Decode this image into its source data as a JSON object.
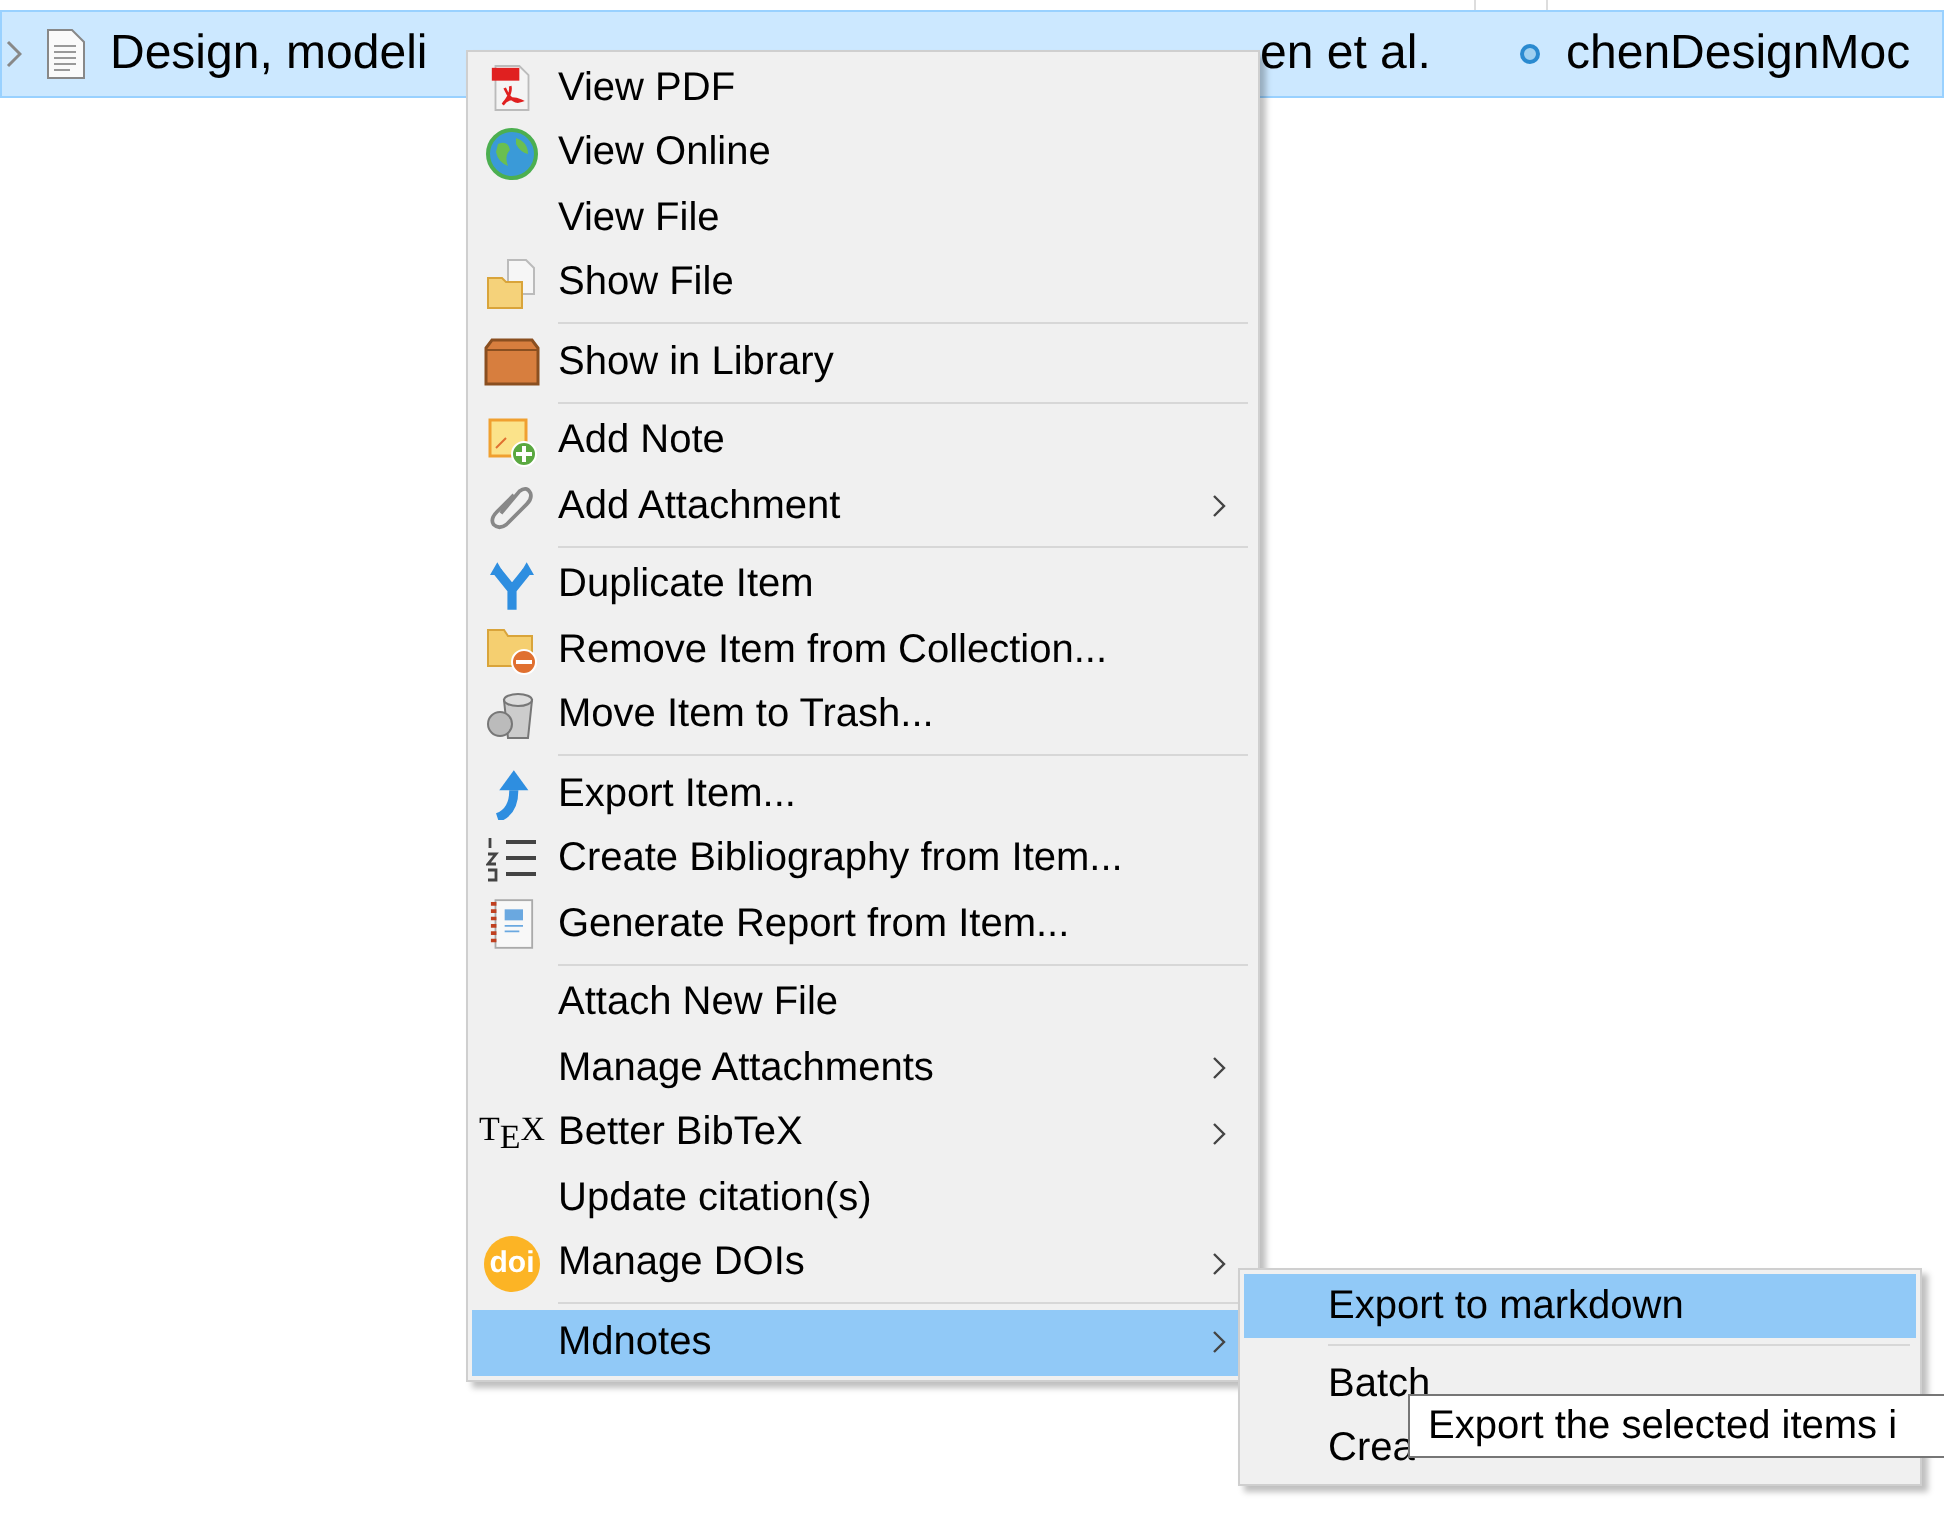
{
  "item_row": {
    "selected": true,
    "title": "Design, modeli",
    "creator": "en et al.",
    "citekey": "chenDesignMoc"
  },
  "context_menu": {
    "sections": [
      {
        "items": [
          {
            "label": "View PDF",
            "submenu": false,
            "selected": false
          },
          {
            "label": "View Online",
            "submenu": false,
            "selected": false
          },
          {
            "label": "View File",
            "submenu": false,
            "selected": false
          },
          {
            "label": "Show File",
            "submenu": false,
            "selected": false
          }
        ]
      },
      {
        "items": [
          {
            "label": "Show in Library",
            "submenu": false,
            "selected": false
          }
        ]
      },
      {
        "items": [
          {
            "label": "Add Note",
            "submenu": false,
            "selected": false
          },
          {
            "label": "Add Attachment",
            "submenu": true,
            "selected": false
          }
        ]
      },
      {
        "items": [
          {
            "label": "Duplicate Item",
            "submenu": false,
            "selected": false
          },
          {
            "label": "Remove Item from Collection...",
            "submenu": false,
            "selected": false
          },
          {
            "label": "Move Item to Trash...",
            "submenu": false,
            "selected": false
          }
        ]
      },
      {
        "items": [
          {
            "label": "Export Item...",
            "submenu": false,
            "selected": false
          },
          {
            "label": "Create Bibliography from Item...",
            "submenu": false,
            "selected": false
          },
          {
            "label": "Generate Report from Item...",
            "submenu": false,
            "selected": false
          }
        ]
      },
      {
        "items": [
          {
            "label": "Attach New File",
            "submenu": false,
            "selected": false
          },
          {
            "label": "Manage Attachments",
            "submenu": true,
            "selected": false
          },
          {
            "label": "Better BibTeX",
            "submenu": true,
            "selected": false,
            "badge": "T$_{E}$X"
          },
          {
            "label": "Update citation(s)",
            "submenu": false,
            "selected": false
          },
          {
            "label": "Manage DOIs",
            "submenu": true,
            "selected": false,
            "badge": "doi"
          }
        ]
      },
      {
        "items": [
          {
            "label": "Mdnotes",
            "submenu": true,
            "selected": true
          }
        ]
      }
    ]
  },
  "submenu": {
    "sections": [
      {
        "items": [
          {
            "label": "Export to markdown",
            "selected": true
          }
        ]
      },
      {
        "items": [
          {
            "label": "Batch",
            "selected": false
          },
          {
            "label": "Crea",
            "selected": false
          }
        ]
      }
    ]
  },
  "tooltip": {
    "text": "Export the selected items i"
  }
}
